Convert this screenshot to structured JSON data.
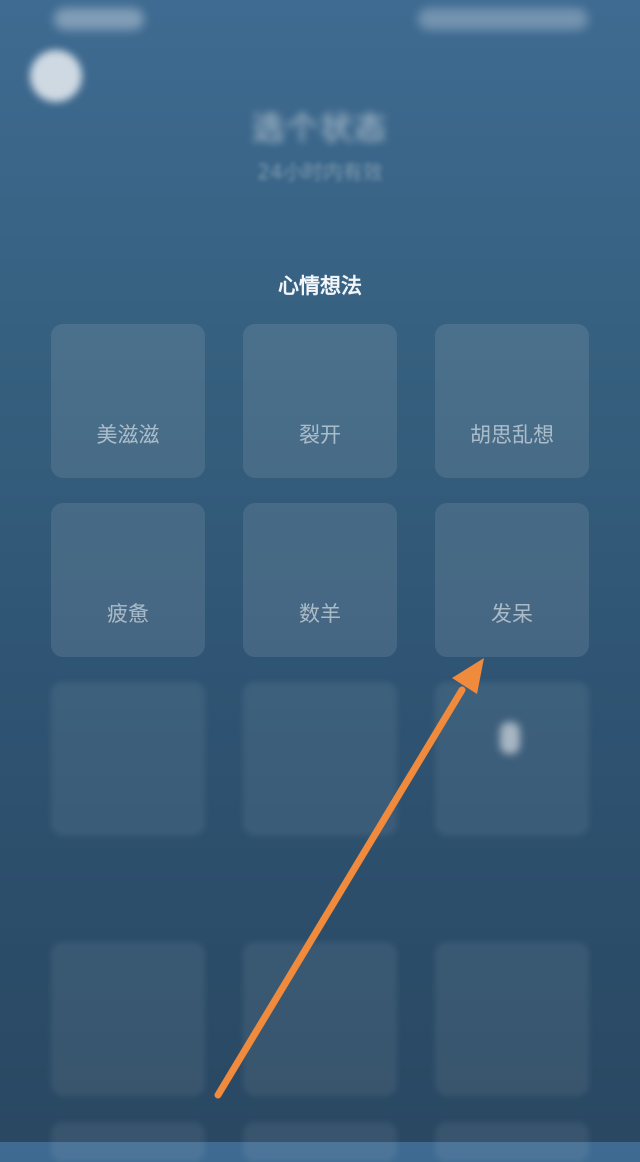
{
  "header": {
    "title": "选个状态",
    "subtitle": "24小时内有效"
  },
  "sections": [
    {
      "title": "心情想法",
      "items": [
        {
          "label": "美滋滋"
        },
        {
          "label": "裂开"
        },
        {
          "label": "胡思乱想"
        },
        {
          "label": "疲惫"
        },
        {
          "label": "数羊"
        },
        {
          "label": "发呆"
        },
        {
          "label": ""
        },
        {
          "label": ""
        },
        {
          "label": ""
        }
      ]
    },
    {
      "title": "",
      "items": [
        {
          "label": ""
        },
        {
          "label": ""
        },
        {
          "label": ""
        }
      ]
    }
  ],
  "colors": {
    "background_top": "#3f6b92",
    "background_bottom": "#2a4862",
    "annotation_arrow": "#f08a3c"
  },
  "annotation": {
    "type": "arrow",
    "target": "发呆"
  }
}
